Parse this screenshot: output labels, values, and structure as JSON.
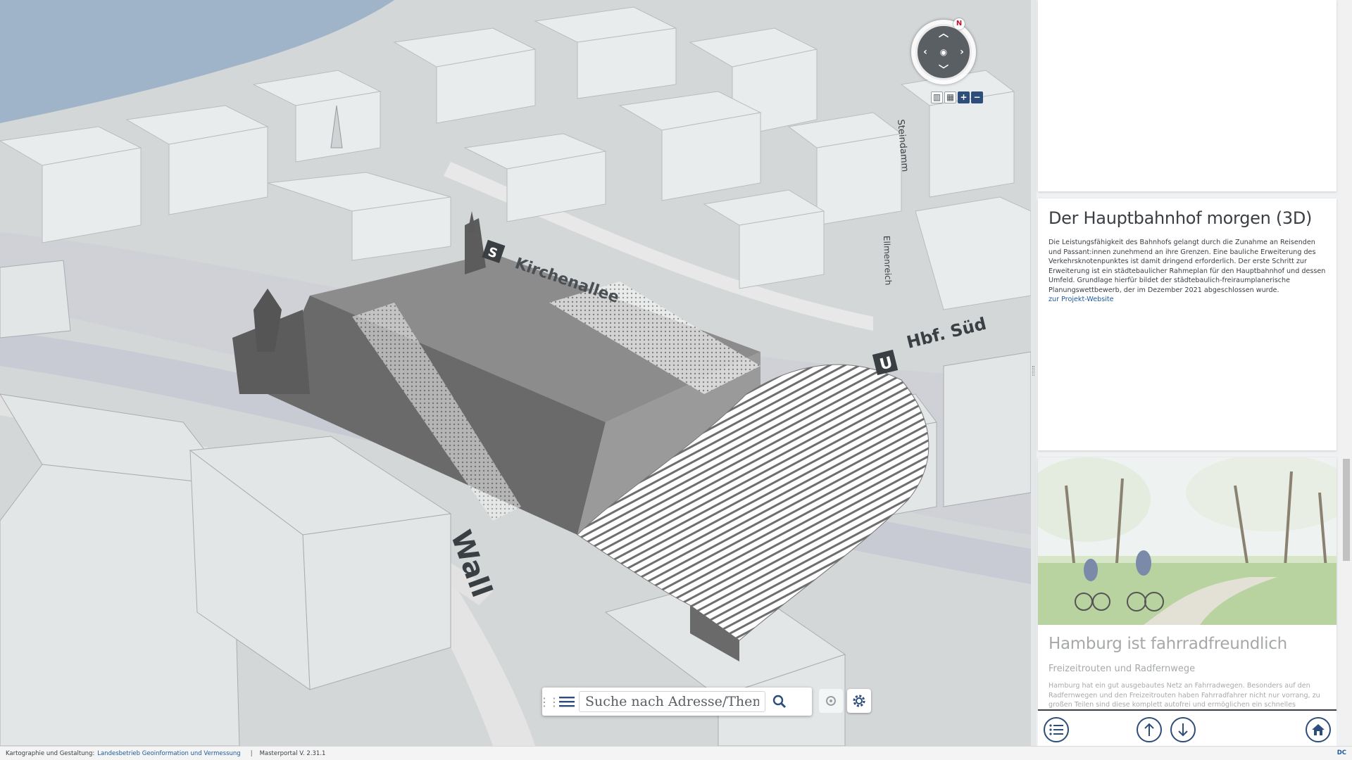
{
  "map": {
    "compass": {
      "north_label": "N"
    },
    "tools": [
      {
        "name": "2d-3d-toggle",
        "label": "▥"
      },
      {
        "name": "grid-toggle",
        "label": "▦"
      },
      {
        "name": "zoom-in",
        "label": "+"
      },
      {
        "name": "zoom-out",
        "label": "−"
      }
    ],
    "street_labels": {
      "kirchenallee": "Kirchenallee",
      "hbf_sued": "Hbf. Süd",
      "u_sign": "U",
      "s_sign": "S",
      "wall": "Wall",
      "steindamm": "Steindamm",
      "ellmenreich": "Ellmenreich"
    },
    "search": {
      "placeholder": "Suche nach Adresse/Thema"
    }
  },
  "panel": {
    "hbf_card": {
      "title": "Der Hauptbahnhof morgen (3D)",
      "body": "Die Leistungsfähigkeit des Bahnhofs gelangt durch die Zunahme an Reisenden und Passant:innen zunehmend an ihre Grenzen. Eine bauliche Erweiterung des Verkehrsknotenpunktes ist damit dringend erforderlich. Der erste Schritt zur Erweiterung ist ein städtebaulicher Rahmeplan für den Hauptbahnhof und dessen Umfeld. Grundlage hierfür bildet der städtebaulich-freiraumplanerische Planungswettbewerb, der im Dezember 2021 abgeschlossen wurde.",
      "link": "zur Projekt-Website"
    },
    "rad_card": {
      "title": "Hamburg ist fahrradfreundlich",
      "subtitle": "Freizeitrouten und Radfernwege",
      "body": "Hamburg hat ein gut ausgebautes Netz an Fahrradwegen. Besonders auf den Radfernwegen und den Freizeitrouten haben Fahrradfahrer nicht nur vorrang, zu großen Teilen sind diese komplett autofrei und ermöglichen ein schnelles"
    }
  },
  "statusbar": {
    "credit_label": "Kartographie und Gestaltung:",
    "credit_link": "Landesbetrieb Geoinformation und Vermessung",
    "separator": "|",
    "version": "Masterportal V. 2.31.1",
    "right_badge": "DC"
  },
  "colors": {
    "accent": "#2d4d7a",
    "link": "#1c5a9a",
    "text": "#3a3f44",
    "water": "#9fb4c8",
    "building": "#e6e9ea",
    "station_roof": "#7c7c7c"
  }
}
